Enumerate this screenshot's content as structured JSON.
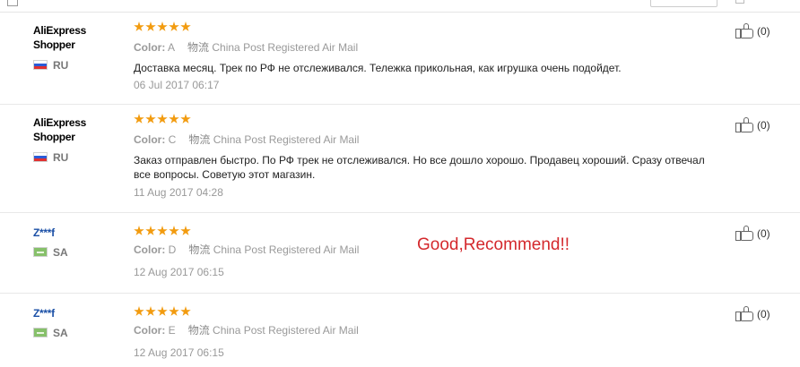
{
  "reviews": [
    {
      "user": "AliExpress Shopper",
      "country": "RU",
      "flag": "russia-flag-icon",
      "color_label": "Color:",
      "color_value": "A",
      "shipping_label": "物流",
      "shipping_value": "China Post Registered Air Mail",
      "content": "Доставка месяц. Трек по РФ не отслеживался. Тележка прикольная, как игрушка очень подойдет.",
      "date": "06 Jul 2017 06:17",
      "helpful": "(0)"
    },
    {
      "user": "AliExpress Shopper",
      "country": "RU",
      "flag": "russia-flag-icon",
      "color_label": "Color:",
      "color_value": "C",
      "shipping_label": "物流",
      "shipping_value": "China Post Registered Air Mail",
      "content": "Заказ отправлен быстро. По РФ трек не отслеживался. Но все дошло хорошо. Продавец хороший. Сразу отвечал все вопросы. Советую этот магазин.",
      "date": "11 Aug 2017 04:28",
      "helpful": "(0)"
    },
    {
      "user": "Z***f",
      "country": "SA",
      "flag": "saudi-arabia-flag-icon",
      "color_label": "Color:",
      "color_value": "D",
      "shipping_label": "物流",
      "shipping_value": "China Post Registered Air Mail",
      "content": "",
      "date": "12 Aug 2017 06:15",
      "helpful": "(0)"
    },
    {
      "user": "Z***f",
      "country": "SA",
      "flag": "saudi-arabia-flag-icon",
      "color_label": "Color:",
      "color_value": "E",
      "shipping_label": "物流",
      "shipping_value": "China Post Registered Air Mail",
      "content": "",
      "date": "12 Aug 2017 06:15",
      "helpful": "(0)"
    }
  ],
  "rating": 5,
  "star_color": "#f29b0f",
  "overlay_text": "Good,Recommend!!",
  "overlay_color": "#d4292d",
  "masked_user_color": "#1a4fa6"
}
